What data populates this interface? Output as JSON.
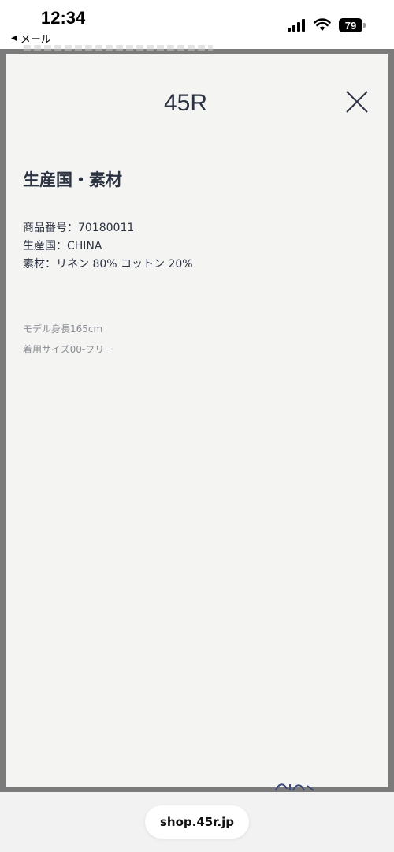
{
  "status_bar": {
    "time": "12:34",
    "back_app": "メール",
    "battery_level": "79"
  },
  "modal": {
    "logo_text": "45R",
    "title": "生産国・素材",
    "specs": [
      "商品番号：70180011",
      "生産国：CHINA",
      "素材：リネン 80% コットン 20%"
    ],
    "model_info": [
      "モデル身長165cm",
      "着用サイズ00-フリー"
    ]
  },
  "browser": {
    "url": "shop.45r.jp"
  },
  "colors": {
    "text_primary": "#2b3241",
    "text_secondary": "#8a8d94",
    "modal_bg": "#f4f4f2",
    "backdrop": "#7b7b7b"
  }
}
